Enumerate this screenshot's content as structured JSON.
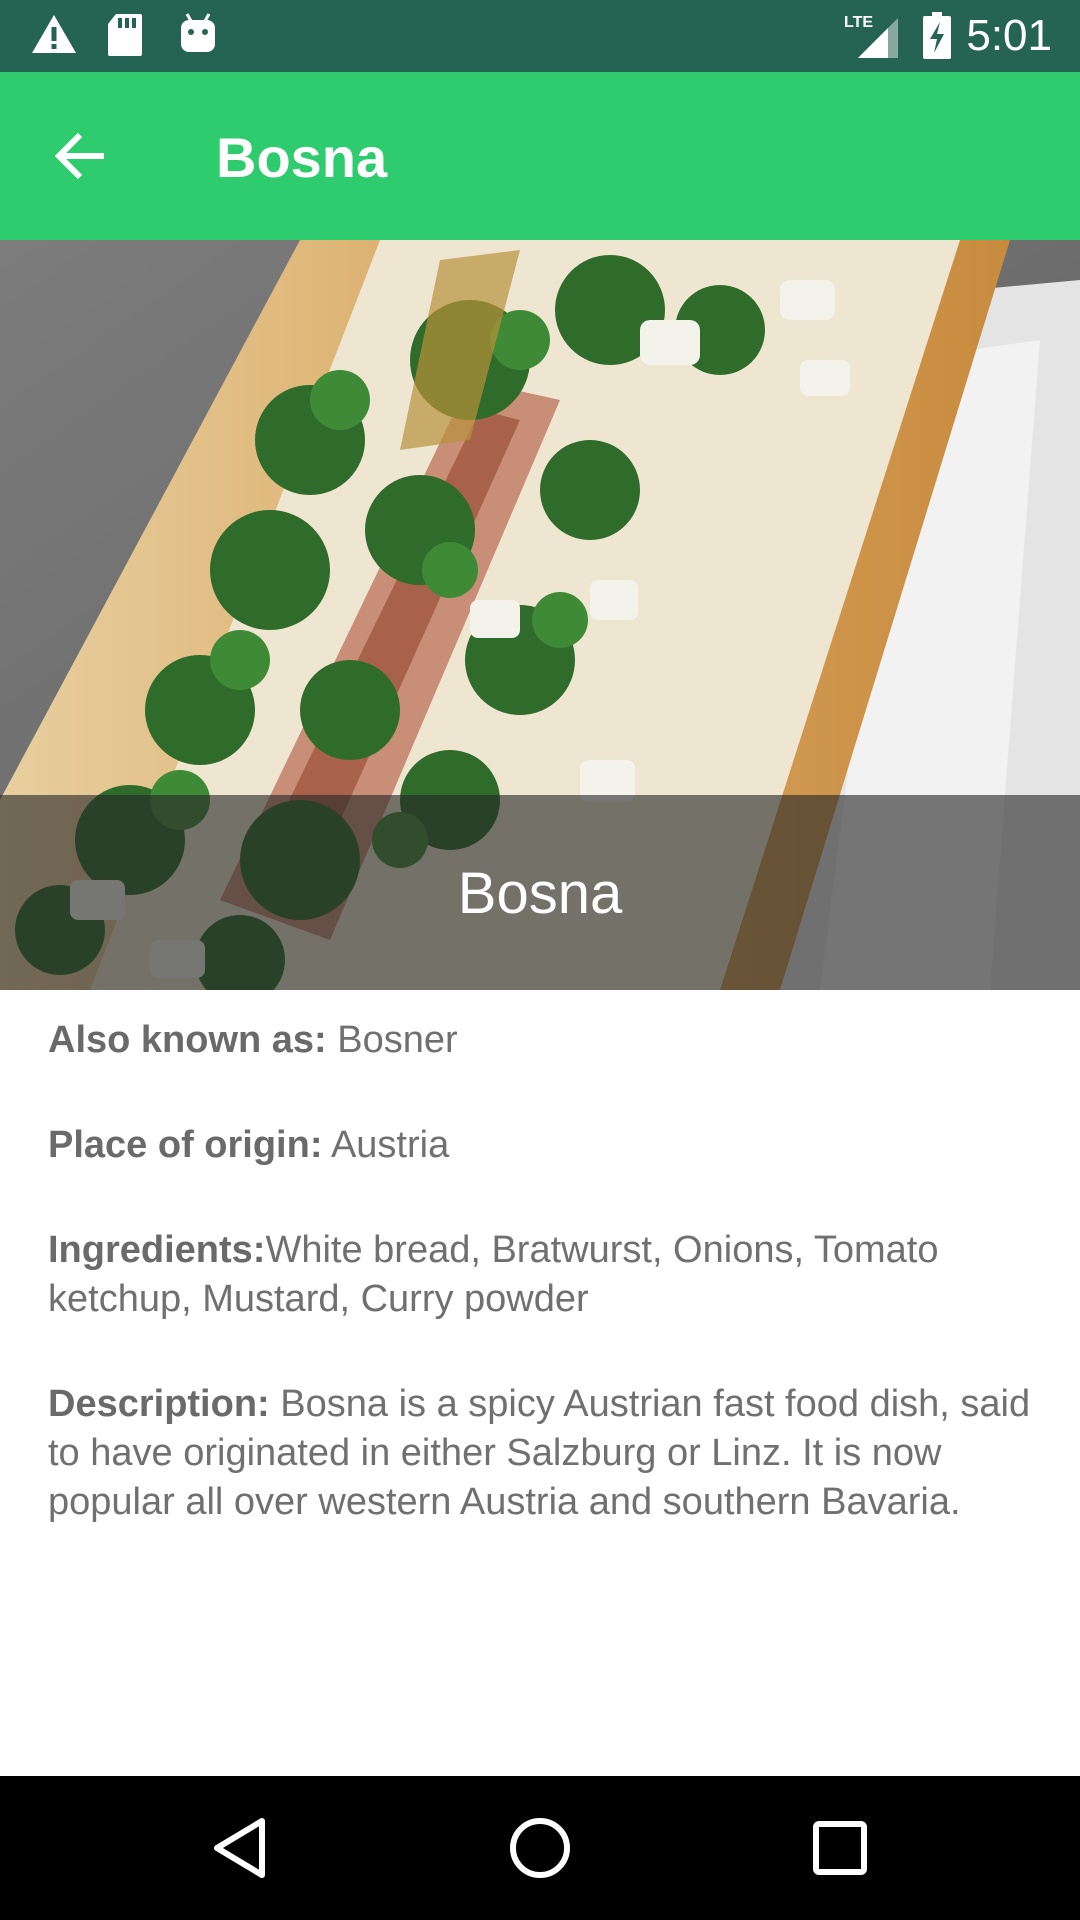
{
  "status_bar": {
    "time": "5:01",
    "icons": [
      "warning-icon",
      "sd-card-icon",
      "android-icon",
      "lte-signal-icon",
      "battery-charging-icon"
    ],
    "network_label": "LTE"
  },
  "app_bar": {
    "title": "Bosna",
    "back_icon": "arrow-back-icon"
  },
  "hero": {
    "image": "bosna-sandwich-photo",
    "caption": "Bosna"
  },
  "details": {
    "also_known_as": {
      "label": "Also known as:",
      "value": " Bosner"
    },
    "place_of_origin": {
      "label": "Place of origin:",
      "value": " Austria"
    },
    "ingredients": {
      "label": "Ingredients:",
      "value": "White bread, Bratwurst, Onions, Tomato ketchup, Mustard, Curry powder"
    },
    "description": {
      "label": "Description:",
      "value": " Bosna is a spicy Austrian fast food dish, said to have originated in either Salzburg or Linz. It is now popular all over western Austria and southern Bavaria."
    }
  },
  "nav_bar": {
    "buttons": [
      "back-triangle-icon",
      "home-circle-icon",
      "recents-square-icon"
    ]
  },
  "colors": {
    "status_bar": "#256352",
    "app_bar": "#2ECC6E",
    "text": "#707070"
  }
}
